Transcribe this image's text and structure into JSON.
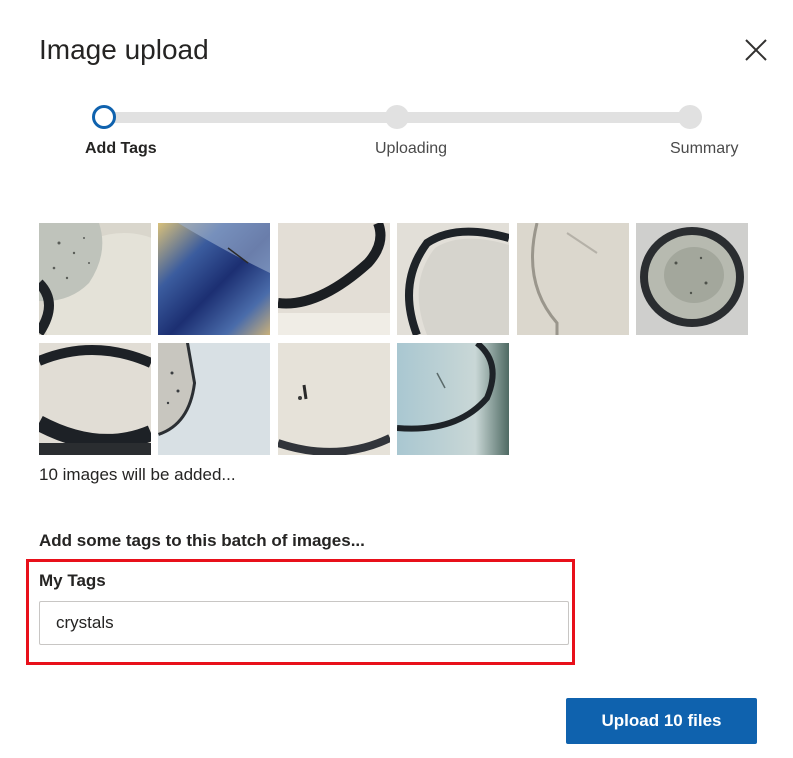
{
  "dialog": {
    "title": "Image upload",
    "close_icon": "close-icon"
  },
  "stepper": {
    "steps": [
      {
        "label": "Add Tags",
        "state": "active"
      },
      {
        "label": "Uploading",
        "state": "pending"
      },
      {
        "label": "Summary",
        "state": "pending"
      }
    ]
  },
  "images": {
    "thumbnails": [
      {
        "name": "crystal-image-1"
      },
      {
        "name": "crystal-image-2"
      },
      {
        "name": "crystal-image-3"
      },
      {
        "name": "crystal-image-4"
      },
      {
        "name": "crystal-image-5"
      },
      {
        "name": "crystal-image-6"
      },
      {
        "name": "crystal-image-7"
      },
      {
        "name": "crystal-image-8"
      },
      {
        "name": "crystal-image-9"
      },
      {
        "name": "crystal-image-10"
      }
    ],
    "count_text": "10 images will be added..."
  },
  "tags": {
    "section_title": "Add some tags to this batch of images...",
    "field_label": "My Tags",
    "value": "crystals"
  },
  "footer": {
    "upload_label": "Upload 10 files"
  },
  "colors": {
    "accent": "#0f62ae",
    "highlight": "#e8101a"
  }
}
